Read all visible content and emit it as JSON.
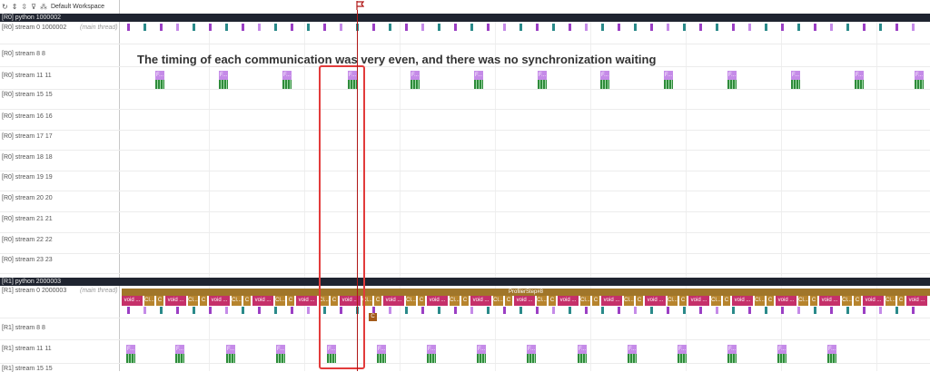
{
  "toolbar": {
    "icons": [
      "refresh-icon",
      "expand-icon",
      "collapse-icon",
      "filter-icon",
      "workspace-icon"
    ],
    "workspace_label": "Default Workspace"
  },
  "processes": [
    {
      "label": "[R0] python 1000002"
    },
    {
      "label": "[R1] python 2000003"
    }
  ],
  "r0_rows": [
    {
      "label": "[R0] stream 0 1000002",
      "thread_tag": "(main thread)"
    },
    {
      "label": "[R0] stream 8 8"
    },
    {
      "label": "[R0] stream 11 11"
    },
    {
      "label": "[R0] stream 15 15"
    },
    {
      "label": "[R0] stream 16 16"
    },
    {
      "label": "[R0] stream 17 17"
    },
    {
      "label": "[R0] stream 18 18"
    },
    {
      "label": "[R0] stream 19 19"
    },
    {
      "label": "[R0] stream 20 20"
    },
    {
      "label": "[R0] stream 21 21"
    },
    {
      "label": "[R0] stream 22 22"
    },
    {
      "label": "[R0] stream 23 23"
    }
  ],
  "r1_rows": [
    {
      "label": "[R1] stream 0 2000003",
      "thread_tag": "(main thread)"
    },
    {
      "label": "[R1] stream 8 8"
    },
    {
      "label": "[R1] stream 11 11"
    },
    {
      "label": "[R1] stream 15 15"
    }
  ],
  "kernel_label": "F...",
  "profiler_step_label": "ProfilerStep#8",
  "segment_labels": {
    "void": "void ...",
    "ci": "Cl...",
    "c": "C"
  },
  "c_marker_label": "C",
  "annotation": "The timing of each communication was very even, and there was no synchronization waiting",
  "colors": {
    "highlight": "#e23b3b",
    "marker": "#b01616",
    "kernel": "#c58be8",
    "void_segment": "#c5306a"
  }
}
